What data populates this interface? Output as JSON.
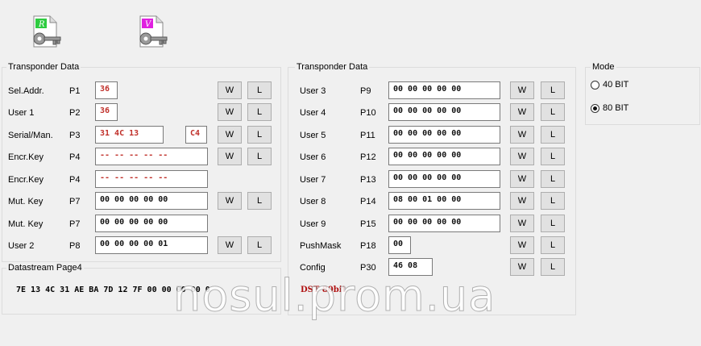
{
  "toolbar": {
    "read_key": {
      "letter": "R",
      "icon": "read-key-icon",
      "color": "#2ecc40"
    },
    "verify_key": {
      "letter": "V",
      "icon": "verify-key-icon",
      "color": "#e020e0"
    }
  },
  "left_panel": {
    "title": "Transponder Data",
    "rows": [
      {
        "label": "Sel.Addr.",
        "page": "P1",
        "value": "36",
        "extra": "",
        "w": "W",
        "l": "L"
      },
      {
        "label": "User 1",
        "page": "P2",
        "value": "36",
        "extra": "",
        "w": "W",
        "l": "L"
      },
      {
        "label": "Serial/Man.",
        "page": "P3",
        "value": "31 4C 13",
        "extra": "C4",
        "w": "W",
        "l": "L"
      },
      {
        "label": "Encr.Key",
        "page": "P4",
        "value": "-- -- -- -- --",
        "extra": "",
        "w": "W",
        "l": "L"
      },
      {
        "label": "Encr.Key",
        "page": "P4",
        "value": "-- -- -- -- --",
        "extra": "",
        "w": "",
        "l": ""
      },
      {
        "label": "Mut. Key",
        "page": "P7",
        "value": "00 00 00 00 00",
        "extra": "",
        "w": "W",
        "l": "L"
      },
      {
        "label": "Mut. Key",
        "page": "P7",
        "value": "00 00 00 00 00",
        "extra": "",
        "w": "",
        "l": ""
      },
      {
        "label": "User 2",
        "page": "P8",
        "value": "00 00 00 00 01",
        "extra": "",
        "w": "W",
        "l": "L"
      }
    ]
  },
  "datastream": {
    "title": "Datastream Page4",
    "value": "7E 13 4C 31 AE BA 7D 12 7F 00 00 00 00 0"
  },
  "right_panel": {
    "title": "Transponder Data",
    "rows": [
      {
        "label": "User 3",
        "page": "P9",
        "value": "00 00 00 00 00",
        "w": "W",
        "l": "L"
      },
      {
        "label": "User 4",
        "page": "P10",
        "value": "00 00 00 00 00",
        "w": "W",
        "l": "L"
      },
      {
        "label": "User 5",
        "page": "P11",
        "value": "00 00 00 00 00",
        "w": "W",
        "l": "L"
      },
      {
        "label": "User 6",
        "page": "P12",
        "value": "00 00 00 00 00",
        "w": "W",
        "l": "L"
      },
      {
        "label": "User 7",
        "page": "P13",
        "value": "00 00 00 00 00",
        "w": "W",
        "l": "L"
      },
      {
        "label": "User 8",
        "page": "P14",
        "value": "08 00 01 00 00",
        "w": "W",
        "l": "L"
      },
      {
        "label": "User 9",
        "page": "P15",
        "value": "00 00 00 00 00",
        "w": "W",
        "l": "L"
      },
      {
        "label": "PushMask",
        "page": "P18",
        "value": "00",
        "w": "W",
        "l": "L"
      },
      {
        "label": "Config",
        "page": "P30",
        "value": "46 08",
        "w": "W",
        "l": "L"
      }
    ],
    "status": "DST 80bit"
  },
  "mode": {
    "title": "Mode",
    "options": [
      "40 BIT",
      "80 BIT"
    ],
    "selected": "80 BIT"
  },
  "watermark": "nosul.prom.ua",
  "colors": {
    "value_red": "#c0302a",
    "status_red": "#b01010"
  }
}
